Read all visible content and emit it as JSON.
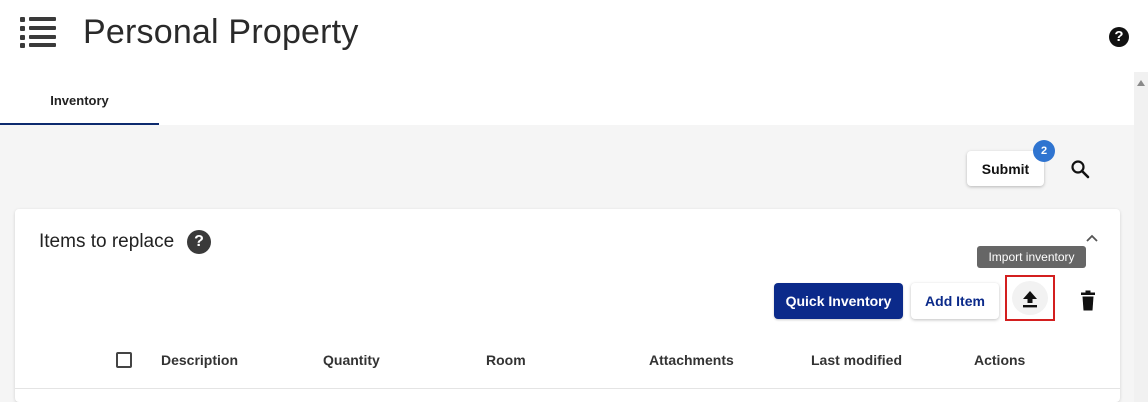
{
  "header": {
    "title": "Personal Property",
    "menu_icon": "list-menu-icon",
    "help_icon": "help-circle-icon",
    "help_glyph": "?"
  },
  "tabs": [
    {
      "label": "Inventory",
      "active": true
    }
  ],
  "toolbar": {
    "submit_label": "Submit",
    "submit_badge": "2",
    "search_icon": "search-icon"
  },
  "section": {
    "title": "Items to replace",
    "help_glyph": "?",
    "collapse_icon": "chevron-up-icon",
    "tooltip": "Import inventory",
    "quick_inventory_label": "Quick Inventory",
    "add_item_label": "Add Item",
    "import_icon": "upload-icon",
    "delete_icon": "trash-icon"
  },
  "table": {
    "columns": [
      "Description",
      "Quantity",
      "Room",
      "Attachments",
      "Last modified",
      "Actions"
    ]
  },
  "colors": {
    "primary": "#0b2a8a",
    "badge": "#2f74d0",
    "highlight": "#d31f1f",
    "tab_underline": "#0d2a6e"
  }
}
